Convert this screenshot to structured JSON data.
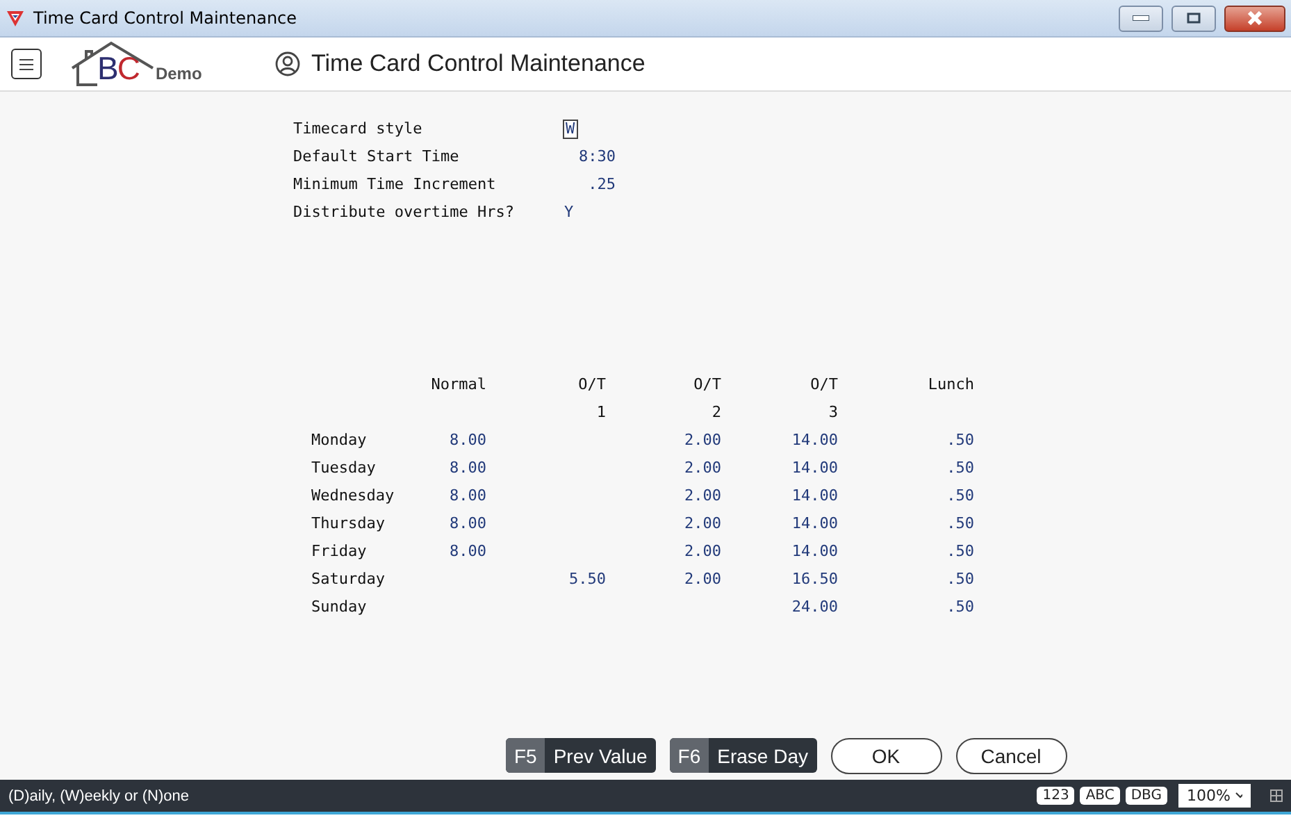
{
  "window": {
    "title": "Time Card Control Maintenance"
  },
  "header": {
    "logo_text": "BC",
    "logo_caption": "Demo",
    "title": "Time Card Control Maintenance"
  },
  "fields": [
    {
      "label": "Timecard style",
      "value": "W",
      "kind": "char",
      "focused": true
    },
    {
      "label": "Default Start Time",
      "value": "8:30",
      "kind": "number",
      "focused": false
    },
    {
      "label": "Minimum Time Increment",
      "value": ".25",
      "kind": "number",
      "focused": false
    },
    {
      "label": "Distribute overtime Hrs?",
      "value": "Y",
      "kind": "char",
      "focused": false
    }
  ],
  "table": {
    "columns": [
      {
        "label": "Normal"
      },
      {
        "label": "O/T",
        "sub": "1"
      },
      {
        "label": "O/T",
        "sub": "2"
      },
      {
        "label": "O/T",
        "sub": "3"
      },
      {
        "label": "Lunch"
      }
    ],
    "rows": [
      {
        "day": "Monday",
        "cells": [
          "8.00",
          null,
          "2.00",
          "14.00",
          ".50"
        ]
      },
      {
        "day": "Tuesday",
        "cells": [
          "8.00",
          null,
          "2.00",
          "14.00",
          ".50"
        ]
      },
      {
        "day": "Wednesday",
        "cells": [
          "8.00",
          null,
          "2.00",
          "14.00",
          ".50"
        ]
      },
      {
        "day": "Thursday",
        "cells": [
          "8.00",
          null,
          "2.00",
          "14.00",
          ".50"
        ]
      },
      {
        "day": "Friday",
        "cells": [
          "8.00",
          null,
          "2.00",
          "14.00",
          ".50"
        ]
      },
      {
        "day": "Saturday",
        "cells": [
          null,
          "5.50",
          "2.00",
          "16.50",
          ".50"
        ]
      },
      {
        "day": "Sunday",
        "cells": [
          null,
          null,
          null,
          "24.00",
          ".50"
        ]
      }
    ]
  },
  "buttons": [
    {
      "kind": "fkey",
      "key": "F5",
      "label": "Prev Value"
    },
    {
      "kind": "fkey",
      "key": "F6",
      "label": "Erase Day"
    },
    {
      "kind": "plain",
      "label": "OK"
    },
    {
      "kind": "plain",
      "label": "Cancel"
    }
  ],
  "status_bar": {
    "message": "(D)aily, (W)eekly or (N)one",
    "badges": [
      "123",
      "ABC",
      "DBG"
    ],
    "zoom": "100%"
  }
}
